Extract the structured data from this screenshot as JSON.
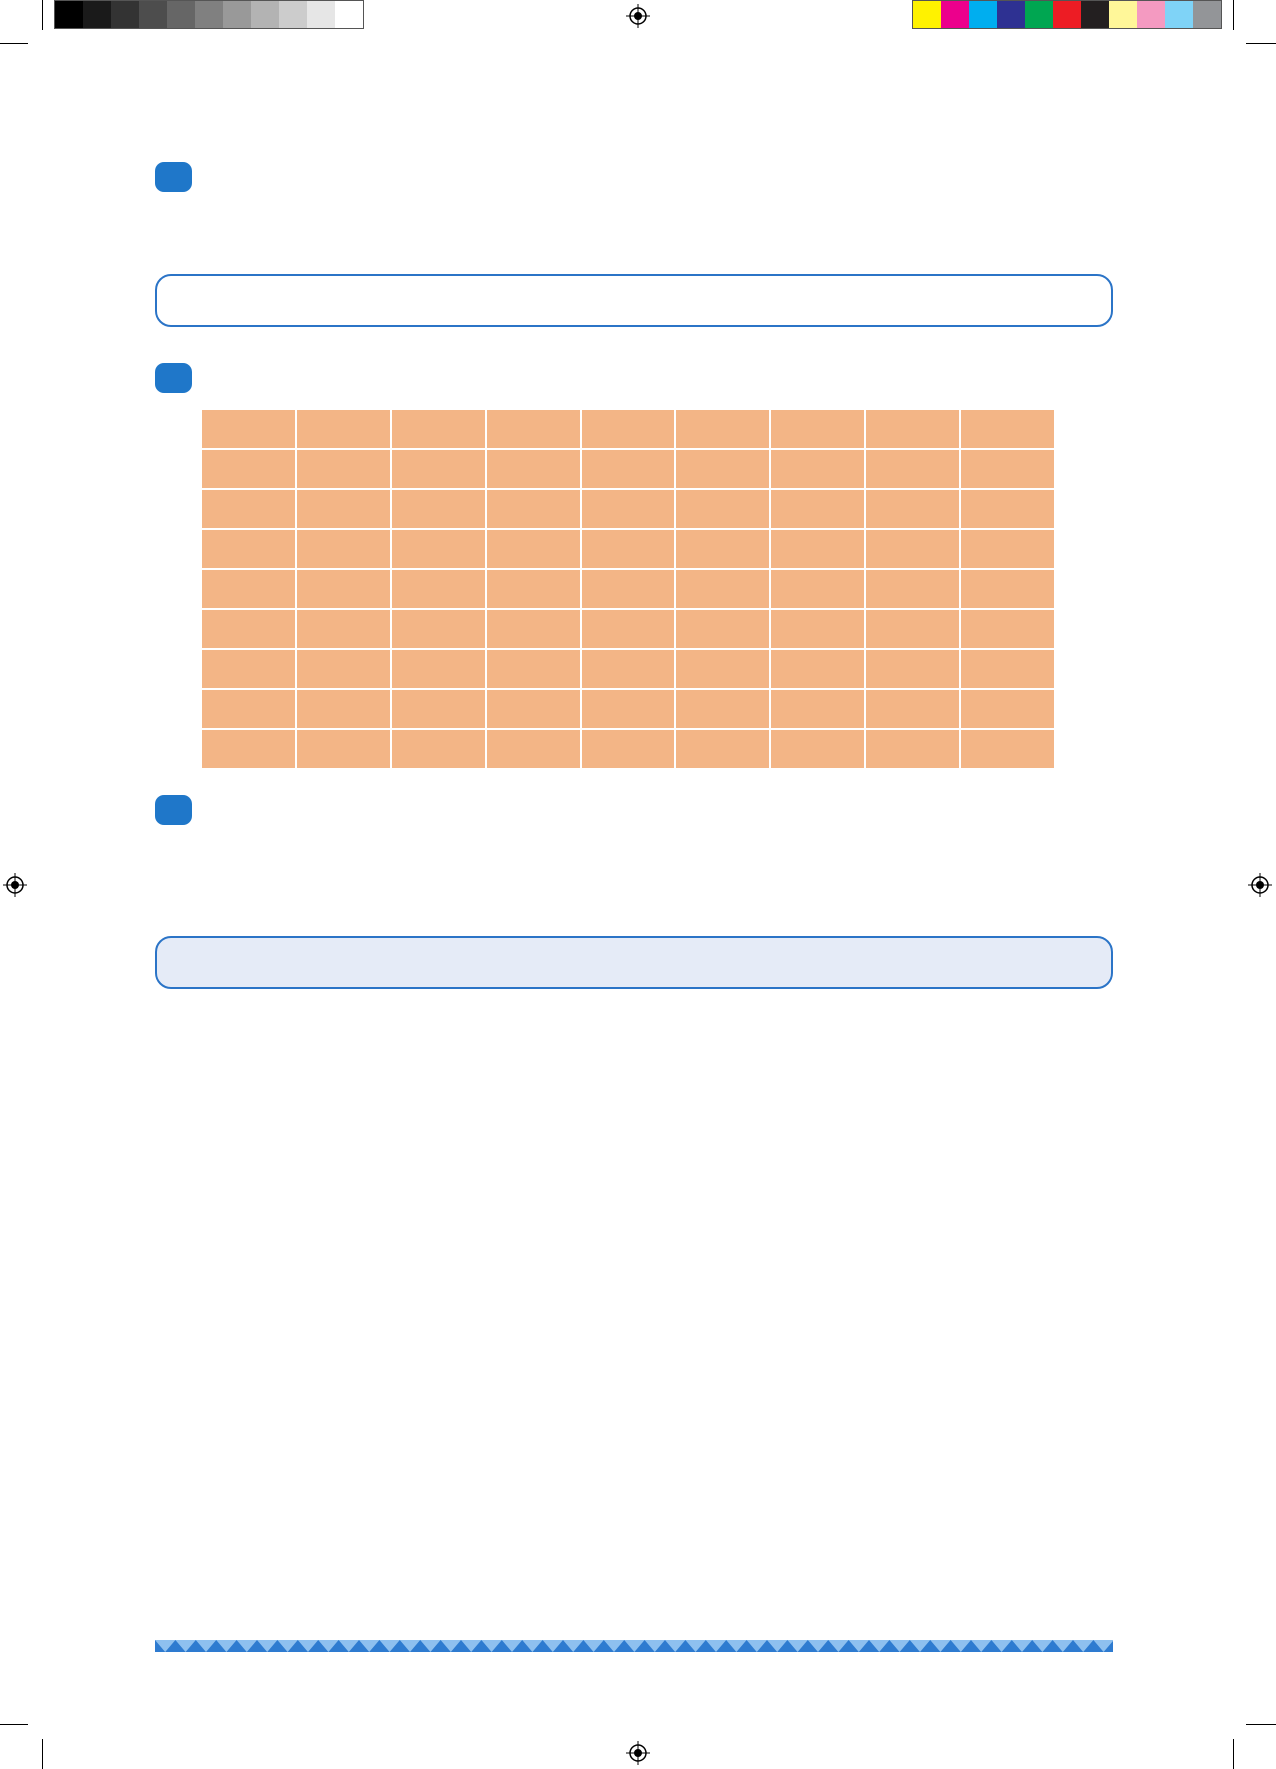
{
  "colors": {
    "badge": "#1f77c9",
    "box_border": "#2b74c7",
    "box3_fill": "#e5ebf7",
    "grid_cell": "#f3b586",
    "footer_dark": "#2e7bd0",
    "footer_light": "#8ec0ef"
  },
  "gray_swatches": [
    "#000000",
    "#1a1a1a",
    "#333333",
    "#4d4d4d",
    "#666666",
    "#808080",
    "#999999",
    "#b3b3b3",
    "#cccccc",
    "#e6e6e6",
    "#ffffff"
  ],
  "color_swatches": [
    "#fff200",
    "#ec008c",
    "#00aeef",
    "#2e3192",
    "#00a651",
    "#ed1c24",
    "#231f20",
    "#fff799",
    "#f49ac1",
    "#7fd3f7",
    "#939598"
  ],
  "grid": {
    "rows": 9,
    "cols": 9
  },
  "icons": {
    "registration": "registration-mark-icon",
    "badge": "number-badge"
  }
}
